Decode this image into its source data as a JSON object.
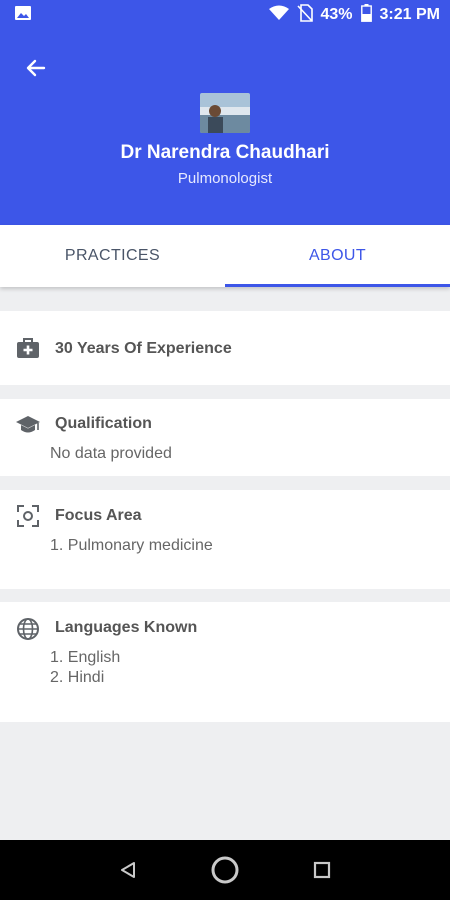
{
  "status_bar": {
    "battery": "43%",
    "time": "3:21 PM",
    "icons": [
      "image-icon",
      "wifi-icon",
      "no-sim-icon",
      "battery-icon"
    ]
  },
  "header": {
    "doctor_name": "Dr Narendra Chaudhari",
    "specialty": "Pulmonologist",
    "accent_color": "#3d56e8"
  },
  "tabs": [
    {
      "label": "PRACTICES",
      "active": false
    },
    {
      "label": "ABOUT",
      "active": true
    }
  ],
  "about": {
    "experience": {
      "title": "30 Years Of Experience",
      "icon": "medical-bag-icon"
    },
    "qualification": {
      "title": "Qualification",
      "value": "No data provided",
      "icon": "graduation-cap-icon"
    },
    "focus_area": {
      "title": "Focus Area",
      "items": [
        "1. Pulmonary medicine"
      ],
      "icon": "focus-icon"
    },
    "languages": {
      "title": "Languages Known",
      "items": [
        "1. English",
        "2. Hindi"
      ],
      "icon": "globe-icon"
    }
  },
  "nav_bar": {
    "icons": [
      "back-triangle-icon",
      "home-circle-icon",
      "recents-square-icon"
    ]
  }
}
